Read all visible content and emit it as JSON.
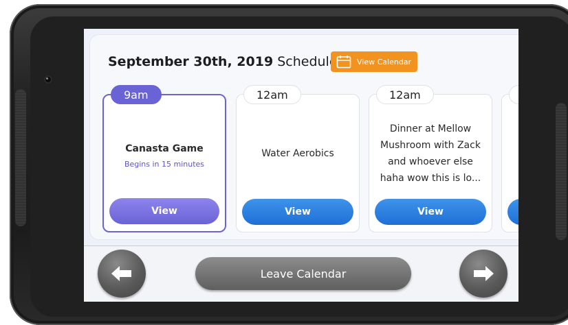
{
  "header": {
    "date": "September 30th, 2019",
    "suffix": "Schedule",
    "view_calendar_label": "View Calendar"
  },
  "events": [
    {
      "time": "9am",
      "title": "Canasta Game",
      "subtitle": "Begins in 15 minutes",
      "button": "View"
    },
    {
      "time": "12am",
      "title": "Water Aerobics",
      "button": "View"
    },
    {
      "time": "12am",
      "title": "Dinner at Mellow Mushroom with Zack and whoever else haha wow this is lo...",
      "button": "View"
    }
  ],
  "footer": {
    "leave_label": "Leave Calendar"
  },
  "colors": {
    "accent_purple": "#6a63d6",
    "button_blue": "#1f6fd6",
    "orange": "#f2931f"
  }
}
